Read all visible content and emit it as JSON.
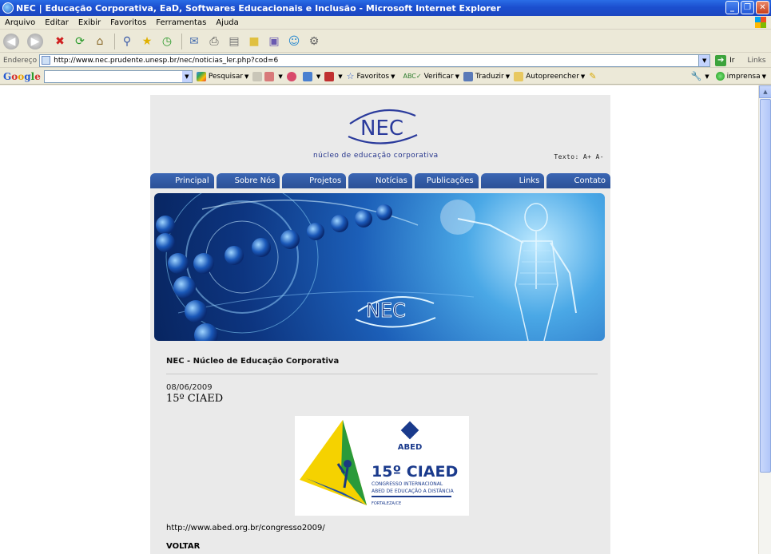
{
  "window": {
    "title": "NEC | Educação Corporativa, EaD, Softwares Educacionais e Inclusão - Microsoft Internet Explorer",
    "controls": [
      "_",
      "❐",
      "✕"
    ]
  },
  "menu": [
    "Arquivo",
    "Editar",
    "Exibir",
    "Favoritos",
    "Ferramentas",
    "Ajuda"
  ],
  "address": {
    "label": "Endereço",
    "url": "http://www.nec.prudente.unesp.br/nec/noticias_ler.php?cod=6",
    "go": "Ir",
    "links": "Links"
  },
  "google_bar": {
    "logo": [
      "G",
      "o",
      "o",
      "g",
      "l",
      "e"
    ],
    "search_value": "",
    "pesquisar": "Pesquisar",
    "favoritos": "Favoritos",
    "verificar": "Verificar",
    "traduzir": "Traduzir",
    "autopreencher": "Autopreencher",
    "imprensa": "imprensa"
  },
  "page": {
    "logo_text": "NEC",
    "logo_subtitle": "núcleo de educação corporativa",
    "text_size": "Texto: A+ A-",
    "nav": [
      "Principal",
      "Sobre Nós",
      "Projetos",
      "Notícias",
      "Publicações",
      "Links",
      "Contato"
    ],
    "banner_logo": "NEC",
    "site_title": "NEC - Núcleo de Educação Corporativa",
    "news_date": "08/06/2009",
    "news_title": "15º CIAED",
    "event_image": {
      "org": "ABED",
      "title": "15º CIAED",
      "line1": "CONGRESSO INTERNACIONAL",
      "line2": "ABED DE EDUCAÇÃO A DISTÂNCIA",
      "city": "FORTALEZA/CE"
    },
    "link": "http://www.abed.org.br/congresso2009/",
    "back": "VOLTAR"
  }
}
